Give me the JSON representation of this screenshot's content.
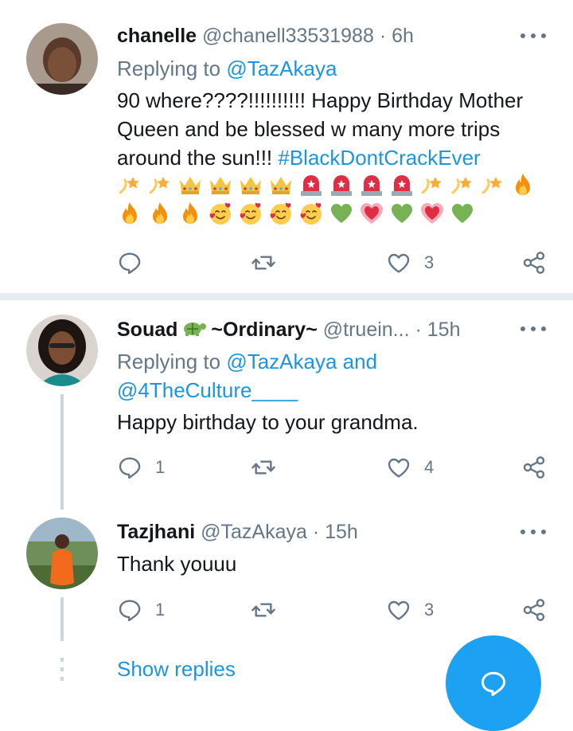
{
  "tweets": [
    {
      "name": "chanelle",
      "handle": "@chanell33531988",
      "dot": "·",
      "time": "6h",
      "replying_prefix": "Replying to",
      "replying_to": "@TazAkaya",
      "text": "90 where????!!!!!!!!!! Happy Birthday Mother Queen and be blessed w many more trips around the sun!!! ",
      "hashtag": "#BlackDontCrackEver",
      "emojis": [
        "dizzy-icon",
        "dizzy-icon",
        "crown-icon",
        "crown-icon",
        "crown-icon",
        "crown-icon",
        "siren-icon",
        "siren-icon",
        "siren-icon",
        "siren-icon",
        "dizzy-icon",
        "dizzy-icon",
        "dizzy-icon",
        "fire-icon",
        "fire-icon",
        "fire-icon",
        "fire-icon",
        "smiling-hearts-icon",
        "smiling-hearts-icon",
        "smiling-hearts-icon",
        "smiling-hearts-icon",
        "green-heart-icon",
        "growing-heart-icon",
        "green-heart-icon",
        "growing-heart-icon",
        "green-heart-icon"
      ],
      "reply_count": "",
      "like_count": "3"
    },
    {
      "name": "Souad",
      "name_suffix": "~Ordinary~",
      "name_emoji": "turtle-icon",
      "handle": "@truein...",
      "dot": "·",
      "time": "15h",
      "replying_prefix": "Replying to",
      "replying_to": "@TazAkaya",
      "replying_and": "and",
      "replying_to_2": "@4TheCulture____",
      "text": "Happy birthday to your grandma.",
      "reply_count": "1",
      "like_count": "4"
    },
    {
      "name": "Tazjhani",
      "handle": "@TazAkaya",
      "dot": "·",
      "time": "15h",
      "text": "Thank youuu",
      "reply_count": "1",
      "like_count": "3"
    }
  ],
  "show_replies": "Show replies",
  "colors": {
    "link": "#1b95e0",
    "muted": "#657786",
    "divider": "#e6ecf0",
    "fab": "#1da1f2"
  }
}
